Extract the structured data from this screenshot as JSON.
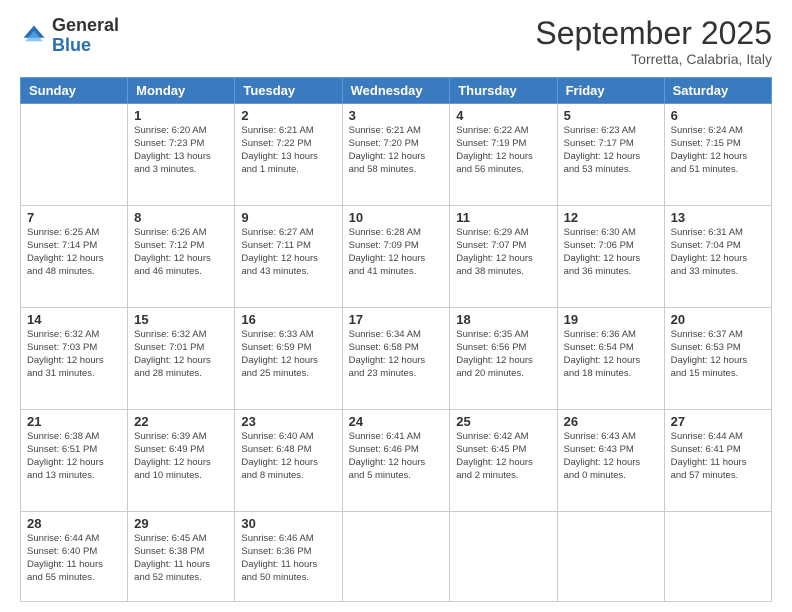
{
  "header": {
    "logo_general": "General",
    "logo_blue": "Blue",
    "month": "September 2025",
    "location": "Torretta, Calabria, Italy"
  },
  "weekdays": [
    "Sunday",
    "Monday",
    "Tuesday",
    "Wednesday",
    "Thursday",
    "Friday",
    "Saturday"
  ],
  "weeks": [
    [
      {
        "day": "",
        "info": ""
      },
      {
        "day": "1",
        "info": "Sunrise: 6:20 AM\nSunset: 7:23 PM\nDaylight: 13 hours\nand 3 minutes."
      },
      {
        "day": "2",
        "info": "Sunrise: 6:21 AM\nSunset: 7:22 PM\nDaylight: 13 hours\nand 1 minute."
      },
      {
        "day": "3",
        "info": "Sunrise: 6:21 AM\nSunset: 7:20 PM\nDaylight: 12 hours\nand 58 minutes."
      },
      {
        "day": "4",
        "info": "Sunrise: 6:22 AM\nSunset: 7:19 PM\nDaylight: 12 hours\nand 56 minutes."
      },
      {
        "day": "5",
        "info": "Sunrise: 6:23 AM\nSunset: 7:17 PM\nDaylight: 12 hours\nand 53 minutes."
      },
      {
        "day": "6",
        "info": "Sunrise: 6:24 AM\nSunset: 7:15 PM\nDaylight: 12 hours\nand 51 minutes."
      }
    ],
    [
      {
        "day": "7",
        "info": "Sunrise: 6:25 AM\nSunset: 7:14 PM\nDaylight: 12 hours\nand 48 minutes."
      },
      {
        "day": "8",
        "info": "Sunrise: 6:26 AM\nSunset: 7:12 PM\nDaylight: 12 hours\nand 46 minutes."
      },
      {
        "day": "9",
        "info": "Sunrise: 6:27 AM\nSunset: 7:11 PM\nDaylight: 12 hours\nand 43 minutes."
      },
      {
        "day": "10",
        "info": "Sunrise: 6:28 AM\nSunset: 7:09 PM\nDaylight: 12 hours\nand 41 minutes."
      },
      {
        "day": "11",
        "info": "Sunrise: 6:29 AM\nSunset: 7:07 PM\nDaylight: 12 hours\nand 38 minutes."
      },
      {
        "day": "12",
        "info": "Sunrise: 6:30 AM\nSunset: 7:06 PM\nDaylight: 12 hours\nand 36 minutes."
      },
      {
        "day": "13",
        "info": "Sunrise: 6:31 AM\nSunset: 7:04 PM\nDaylight: 12 hours\nand 33 minutes."
      }
    ],
    [
      {
        "day": "14",
        "info": "Sunrise: 6:32 AM\nSunset: 7:03 PM\nDaylight: 12 hours\nand 31 minutes."
      },
      {
        "day": "15",
        "info": "Sunrise: 6:32 AM\nSunset: 7:01 PM\nDaylight: 12 hours\nand 28 minutes."
      },
      {
        "day": "16",
        "info": "Sunrise: 6:33 AM\nSunset: 6:59 PM\nDaylight: 12 hours\nand 25 minutes."
      },
      {
        "day": "17",
        "info": "Sunrise: 6:34 AM\nSunset: 6:58 PM\nDaylight: 12 hours\nand 23 minutes."
      },
      {
        "day": "18",
        "info": "Sunrise: 6:35 AM\nSunset: 6:56 PM\nDaylight: 12 hours\nand 20 minutes."
      },
      {
        "day": "19",
        "info": "Sunrise: 6:36 AM\nSunset: 6:54 PM\nDaylight: 12 hours\nand 18 minutes."
      },
      {
        "day": "20",
        "info": "Sunrise: 6:37 AM\nSunset: 6:53 PM\nDaylight: 12 hours\nand 15 minutes."
      }
    ],
    [
      {
        "day": "21",
        "info": "Sunrise: 6:38 AM\nSunset: 6:51 PM\nDaylight: 12 hours\nand 13 minutes."
      },
      {
        "day": "22",
        "info": "Sunrise: 6:39 AM\nSunset: 6:49 PM\nDaylight: 12 hours\nand 10 minutes."
      },
      {
        "day": "23",
        "info": "Sunrise: 6:40 AM\nSunset: 6:48 PM\nDaylight: 12 hours\nand 8 minutes."
      },
      {
        "day": "24",
        "info": "Sunrise: 6:41 AM\nSunset: 6:46 PM\nDaylight: 12 hours\nand 5 minutes."
      },
      {
        "day": "25",
        "info": "Sunrise: 6:42 AM\nSunset: 6:45 PM\nDaylight: 12 hours\nand 2 minutes."
      },
      {
        "day": "26",
        "info": "Sunrise: 6:43 AM\nSunset: 6:43 PM\nDaylight: 12 hours\nand 0 minutes."
      },
      {
        "day": "27",
        "info": "Sunrise: 6:44 AM\nSunset: 6:41 PM\nDaylight: 11 hours\nand 57 minutes."
      }
    ],
    [
      {
        "day": "28",
        "info": "Sunrise: 6:44 AM\nSunset: 6:40 PM\nDaylight: 11 hours\nand 55 minutes."
      },
      {
        "day": "29",
        "info": "Sunrise: 6:45 AM\nSunset: 6:38 PM\nDaylight: 11 hours\nand 52 minutes."
      },
      {
        "day": "30",
        "info": "Sunrise: 6:46 AM\nSunset: 6:36 PM\nDaylight: 11 hours\nand 50 minutes."
      },
      {
        "day": "",
        "info": ""
      },
      {
        "day": "",
        "info": ""
      },
      {
        "day": "",
        "info": ""
      },
      {
        "day": "",
        "info": ""
      }
    ]
  ]
}
